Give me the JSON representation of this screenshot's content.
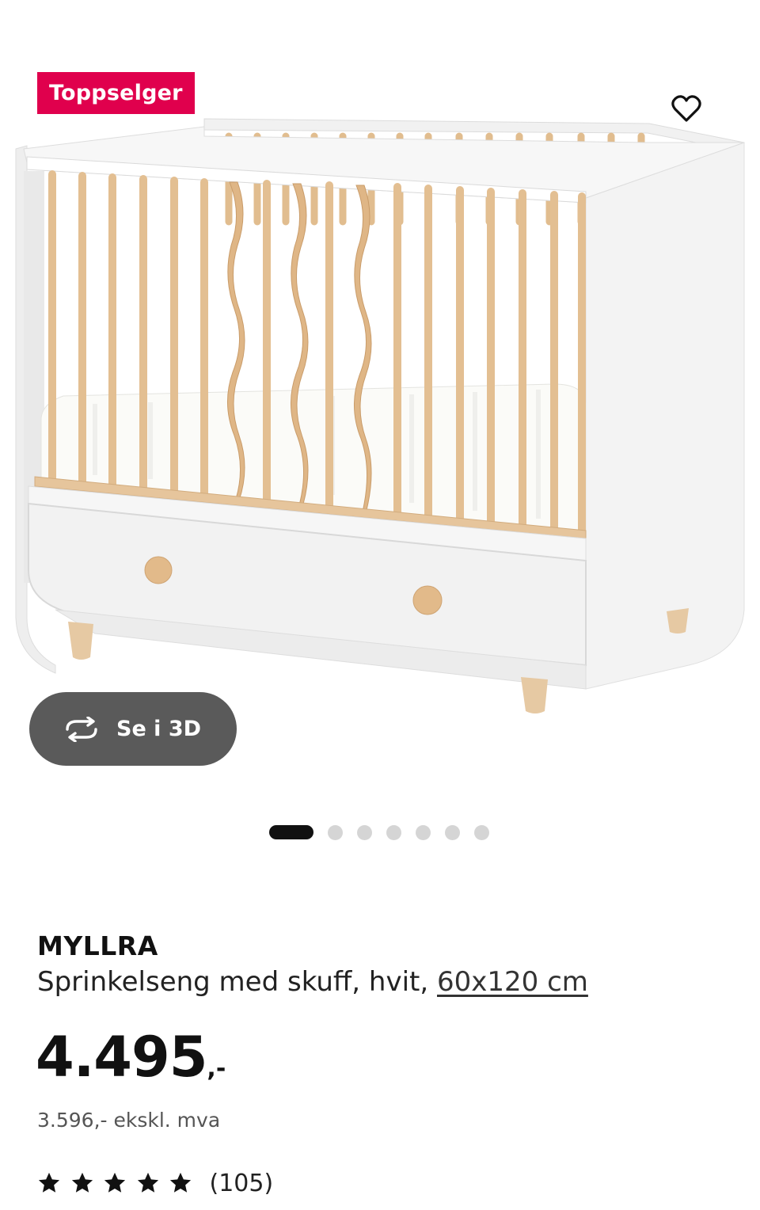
{
  "product": {
    "badge": "Toppselger",
    "view_3d_label": "Se i 3D",
    "gallery": {
      "image_count": 7,
      "active_index": 0
    },
    "brand": "MYLLRA",
    "description_prefix": "Sprinkelseng med skuff, hvit, ",
    "size_link": "60x120 cm",
    "price_main": "4.495",
    "price_suffix": ",-",
    "price_ex_vat": "3.596,- ekskl. mva",
    "rating": {
      "stars": 5,
      "max": 5,
      "count_text": "(105)"
    }
  },
  "icons": {
    "favorite": "heart-outline-icon",
    "view3d": "rotate-arrows-icon",
    "rating": "star-icon"
  },
  "colors": {
    "badge_bg": "#e0004d",
    "view3d_bg": "#5a5a5a",
    "text": "#111111",
    "dot_inactive": "#d5d5d5",
    "wood": "#e3bf92"
  }
}
